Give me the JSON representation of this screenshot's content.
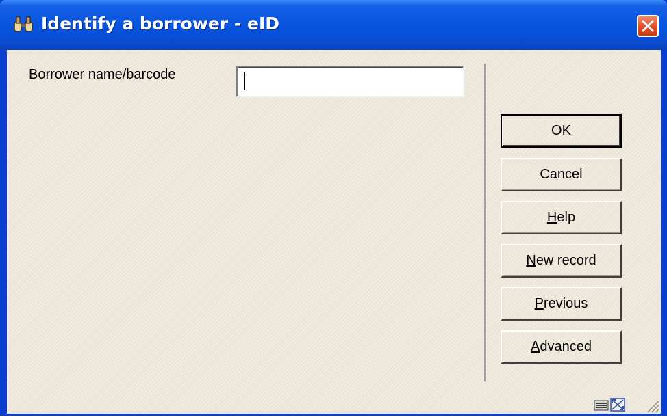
{
  "window": {
    "title": "Identify a borrower - eID",
    "close_icon": "close-icon",
    "app_icon": "binoculars-icon"
  },
  "form": {
    "label": "Borrower name/barcode",
    "input_value": ""
  },
  "buttons": {
    "ok": "OK",
    "cancel": "Cancel",
    "help": {
      "mnemonic": "H",
      "rest": "elp"
    },
    "new_record": {
      "mnemonic": "N",
      "rest": "ew record"
    },
    "previous": {
      "mnemonic": "P",
      "rest": "revious"
    },
    "advanced": {
      "mnemonic": "A",
      "rest": "dvanced"
    }
  },
  "status_bar": {
    "icons": [
      "keyboard-icon",
      "resize-window-icon",
      "size-grip-icon"
    ]
  },
  "colors": {
    "titlebar": "#0753dd",
    "close_button": "#e04a25",
    "dialog_background": "#ece6d9"
  }
}
